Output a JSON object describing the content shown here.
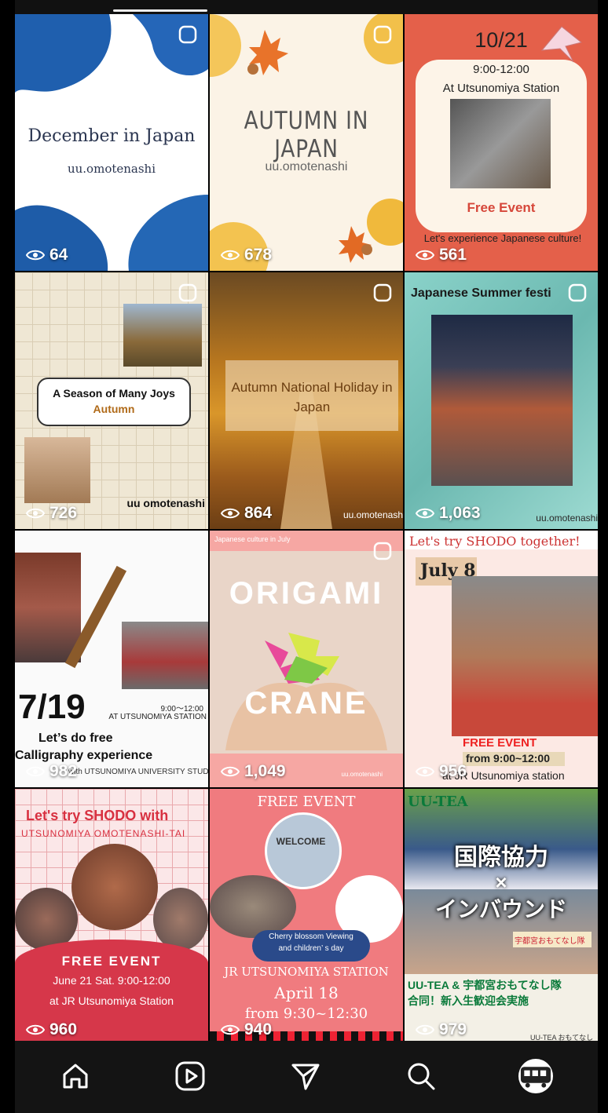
{
  "posts": [
    {
      "title": "December in Japan",
      "subtitle": "uu.omotenashi",
      "views": "64"
    },
    {
      "title": "AUTUMN IN JAPAN",
      "subtitle": "uu.omotenashi",
      "views": "678"
    },
    {
      "date": "10/21",
      "time": "9:00-12:00",
      "location": "At Utsunomiya Station",
      "label": "Free Event",
      "footer": "Let's experience Japanese culture!",
      "views": "561"
    },
    {
      "title": "A Season of Many Joys",
      "subtitle": "Autumn",
      "account": "uu omotenashi",
      "views": "726"
    },
    {
      "title": "Autumn National Holiday in Japan",
      "account": "uu.omotenash",
      "views": "864"
    },
    {
      "title": "Japanese Summer festi",
      "account": "uu.omotenashi",
      "views": "1,063"
    },
    {
      "date": "7/19",
      "time": "9:00〜12:00",
      "location": "AT UTSUNOMIYA STATION",
      "line1": "Let’s do free",
      "line2": "Calligraphy experience",
      "footer": "with UTSUNOMIYA UNIVERSITY STUDENT",
      "views": "982"
    },
    {
      "kicker": "Japanese culture in July",
      "title": "ORIGAMI",
      "subtitle": "CRANE",
      "account": "uu.omotenashi",
      "views": "1,049"
    },
    {
      "title": "Let's try SHODO together!",
      "date": "July 8",
      "label": "FREE EVENT",
      "time": "from 9:00~12:00",
      "location": "at JR Utsunomiya station",
      "views": "956"
    },
    {
      "title": "Let's try SHODO with",
      "subtitle": "UTSUNOMIYA OMOTENASHI-TAI",
      "label": "FREE EVENT",
      "time": "June 21 Sat. 9:00-12:00",
      "location": "at JR Utsunomiya Station",
      "views": "960"
    },
    {
      "title": "FREE EVENT",
      "banner": "WELCOME",
      "caption1": "Cherry blossom Viewing",
      "caption2": "and children’ s day",
      "location": "JR UTSUNOMIYA STATION",
      "date": "April 18",
      "time": "from 9:30~12:30",
      "views": "940"
    },
    {
      "title": "UU-TEA",
      "jp1": "国際協力",
      "cross": "×",
      "jp2": "インバウンド",
      "tag": "宇都宮おもてなし隊",
      "line1": "UU-TEA & 宇都宮おもてなし隊",
      "line2": "合同！新入生歓迎会実施",
      "footer": "UU-TEA おもてなし",
      "views": "979"
    }
  ],
  "nav": {
    "items": [
      "home-icon",
      "reels-icon",
      "messages-icon",
      "search-icon",
      "profile-avatar"
    ]
  },
  "colors": {
    "background": "#000000",
    "navbar": "#141414",
    "coral": "#e4604a",
    "pink": "#f07b7f",
    "teal": "#7fc7c0"
  }
}
